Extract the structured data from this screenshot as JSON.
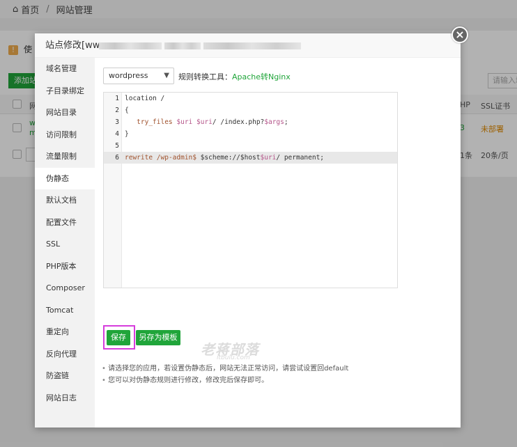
{
  "background": {
    "breadcrumb": {
      "home": "首页",
      "separator": "/",
      "current": "网站管理"
    },
    "tip_text": "使",
    "add_button": "添加站",
    "search_placeholder": "请输入域",
    "header_col_php": "HP",
    "header_col_ssl": "SSL证书",
    "row_col_letter": "网",
    "row_php_value": "3",
    "row_ssl_value": "未部署",
    "row_site_a": "w",
    "row_site_b": "m",
    "pager_count": "1条",
    "pager_per_page": "20条/页"
  },
  "modal": {
    "title": "站点修改[www",
    "close_icon": "close-icon",
    "sidebar": [
      {
        "label": "域名管理",
        "active": false
      },
      {
        "label": "子目录绑定",
        "active": false
      },
      {
        "label": "网站目录",
        "active": false
      },
      {
        "label": "访问限制",
        "active": false
      },
      {
        "label": "流量限制",
        "active": false
      },
      {
        "label": "伪静态",
        "active": true
      },
      {
        "label": "默认文档",
        "active": false
      },
      {
        "label": "配置文件",
        "active": false
      },
      {
        "label": "SSL",
        "active": false
      },
      {
        "label": "PHP版本",
        "active": false
      },
      {
        "label": "Composer",
        "active": false
      },
      {
        "label": "Tomcat",
        "active": false
      },
      {
        "label": "重定向",
        "active": false
      },
      {
        "label": "反向代理",
        "active": false
      },
      {
        "label": "防盗链",
        "active": false
      },
      {
        "label": "网站日志",
        "active": false
      }
    ],
    "rewrite": {
      "selected": "wordpress",
      "tool_label": "规则转换工具：",
      "tool_link": "Apache转Nginx",
      "editor_lines": [
        {
          "num": "1",
          "text": "location /"
        },
        {
          "num": "2",
          "text": "{"
        },
        {
          "num": "3",
          "text": "   try_files $uri $uri/ /index.php?$args;"
        },
        {
          "num": "4",
          "text": "}"
        },
        {
          "num": "5",
          "text": ""
        },
        {
          "num": "6",
          "text": "rewrite /wp-admin$ $scheme://$host$uri/ permanent;"
        }
      ],
      "save_label": "保存",
      "save_as_template_label": "另存为模板",
      "tips": [
        "请选择您的应用，若设置伪静态后，网站无法正常访问，请尝试设置回default",
        "您可以对伪静态规则进行修改，修改完后保存即可。"
      ]
    },
    "watermark": "老蒋部落",
    "watermark_sub": "itbulu.com"
  },
  "colors": {
    "accent": "#20a53a",
    "highlight_box": "#d63ddc",
    "warning": "#e08a00"
  }
}
